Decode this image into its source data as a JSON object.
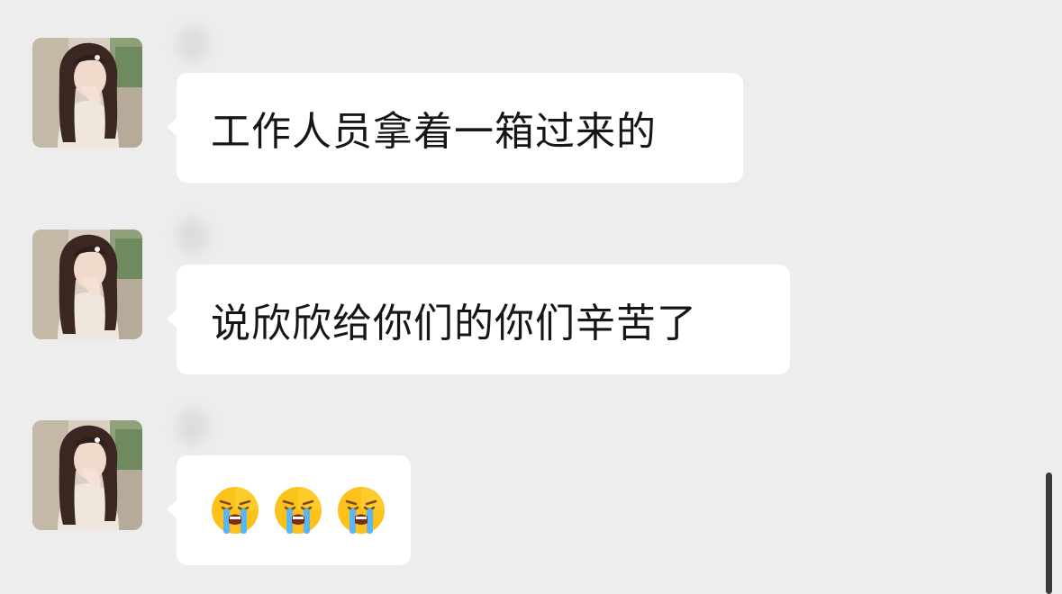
{
  "theme": {
    "background": "#ededed",
    "bubble": "#ffffff",
    "text": "#161616"
  },
  "messages": [
    {
      "sender": "",
      "text": "工作人员拿着一箱过来的",
      "avatar_icon": "profile-photo-icon"
    },
    {
      "sender": "",
      "text": "说欣欣给你们的你们辛苦了",
      "avatar_icon": "profile-photo-icon"
    },
    {
      "sender": "",
      "emojis": [
        "loudly-crying-face-icon",
        "loudly-crying-face-icon",
        "loudly-crying-face-icon"
      ],
      "avatar_icon": "profile-photo-icon"
    }
  ]
}
